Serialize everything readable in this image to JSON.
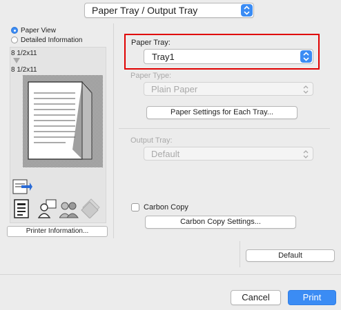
{
  "header": {
    "popup_value": "Paper Tray / Output Tray"
  },
  "left_panel": {
    "view_options": [
      {
        "label": "Paper View",
        "selected": true
      },
      {
        "label": "Detailed Information",
        "selected": false
      }
    ],
    "original_size": "8 1/2x11",
    "output_size": "8 1/2x11",
    "printer_info_button": "Printer Information..."
  },
  "paper_tray": {
    "label": "Paper Tray:",
    "value": "Tray1"
  },
  "paper_type": {
    "label": "Paper Type:",
    "value": "Plain Paper"
  },
  "paper_settings_button": "Paper Settings for Each Tray...",
  "output_tray": {
    "label": "Output Tray:",
    "value": "Default"
  },
  "carbon_copy": {
    "label": "Carbon Copy",
    "checked": false
  },
  "carbon_copy_settings_button": "Carbon Copy Settings...",
  "default_button": "Default",
  "footer": {
    "cancel": "Cancel",
    "print": "Print"
  },
  "colors": {
    "accent": "#3b8cf4",
    "highlight": "#e00000",
    "disabled_text": "#a9a9a9"
  }
}
